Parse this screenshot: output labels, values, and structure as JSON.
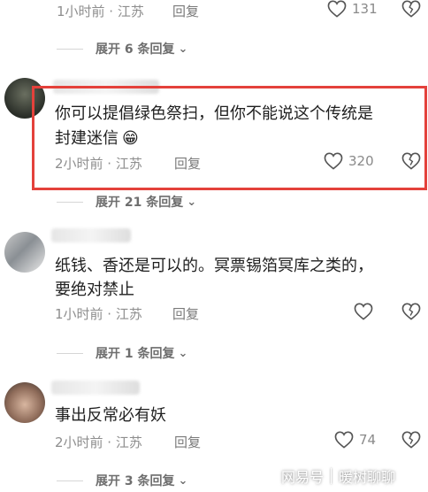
{
  "comments": [
    {
      "text_lines": [],
      "meta": "1小时前 · 江苏",
      "reply_label": "回复",
      "likes": "131",
      "expand_label": "展开 6 条回复"
    },
    {
      "text_lines": [
        "你可以提倡绿色祭扫，但你不能说这个传统是",
        "封建迷信"
      ],
      "emoji": "😁",
      "meta": "2小时前 · 江苏",
      "reply_label": "回复",
      "likes": "320",
      "expand_label": "展开 21 条回复"
    },
    {
      "text_lines": [
        "纸钱、香还是可以的。冥票锡箔冥库之类的，",
        "要绝对禁止"
      ],
      "meta": "1小时前 · 江苏",
      "reply_label": "回复",
      "likes": "",
      "expand_label": "展开 1 条回复"
    },
    {
      "text_lines": [
        "事出反常必有妖"
      ],
      "meta": "2小时前 · 江苏",
      "reply_label": "回复",
      "likes": "74",
      "expand_label": "展开 3 条回复"
    }
  ],
  "watermark": {
    "brand": "网易号",
    "author": "暖树聊聊"
  },
  "colors": {
    "highlight_border": "#e4413b",
    "meta_gray": "#8e8e8e"
  }
}
